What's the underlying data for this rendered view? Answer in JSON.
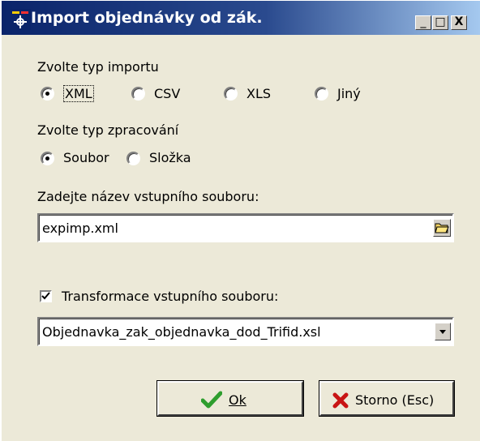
{
  "window": {
    "title": "Import objednávky od zák.",
    "controls": {
      "minimize": "_",
      "maximize": "□",
      "close": "X"
    }
  },
  "import_type": {
    "label": "Zvolte typ importu",
    "options": [
      {
        "label": "XML",
        "selected": true
      },
      {
        "label": "CSV",
        "selected": false
      },
      {
        "label": "XLS",
        "selected": false
      },
      {
        "label": "Jiný",
        "selected": false
      }
    ]
  },
  "processing_type": {
    "label": "Zvolte typ zpracování",
    "options": [
      {
        "label": "Soubor",
        "selected": true
      },
      {
        "label": "Složka",
        "selected": false
      }
    ]
  },
  "input_file": {
    "label": "Zadejte název vstupního souboru:",
    "value": "expimp.xml",
    "browse_icon": "folder-open-icon"
  },
  "transformation": {
    "checkbox_label": "Transformace vstupního souboru:",
    "checked": true,
    "selected_value": "Objednavka_zak_objednavka_dod_Trifid.xsl"
  },
  "buttons": {
    "ok_label": "Ok",
    "cancel_label": "Storno (Esc)"
  },
  "colors": {
    "title_start": "#0a246a",
    "title_end": "#a6caf0",
    "dialog_bg": "#ece9d8",
    "ok_check": "#2e9e2e",
    "cancel_x": "#c81414"
  }
}
